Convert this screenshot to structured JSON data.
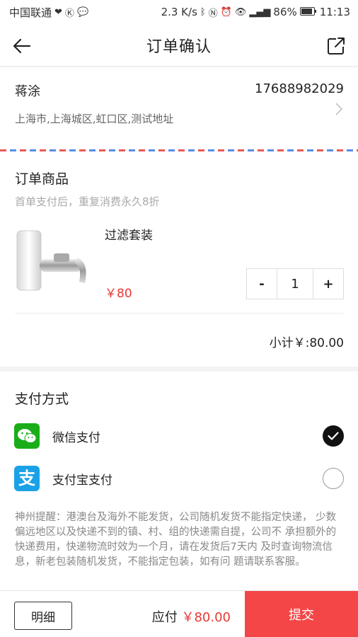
{
  "status_bar": {
    "carrier": "中国联通",
    "speed": "2.3 K/s",
    "battery": "86%",
    "time": "11:13"
  },
  "header": {
    "title": "订单确认",
    "back_icon": "arrow-left-icon",
    "share_icon": "share-icon"
  },
  "address": {
    "name": "蒋涂",
    "phone": "17688982029",
    "address_line": "上海市,上海城区,虹口区,测试地址"
  },
  "goods": {
    "section_title": "订单商品",
    "promo_text": "首单支付后，重复消费永久8折",
    "product": {
      "name": "过滤套装",
      "price": "￥80",
      "quantity": "1",
      "decrement_label": "-",
      "increment_label": "+"
    },
    "subtotal": "小计￥:80.00"
  },
  "payment": {
    "section_title": "支付方式",
    "methods": [
      {
        "label": "微信支付",
        "icon": "wechat-icon",
        "selected": true
      },
      {
        "label": "支付宝支付",
        "icon": "alipay-icon",
        "selected": false
      }
    ],
    "notice": "神州提醒：港澳台及海外不能发货，公司随机发货不能指定快递， 少数偏远地区以及快递不到的镇、村、组的快递需自提，公司不 承担额外的快递费用，快递物流时效为一个月，请在发货后7天内 及时查询物流信息，新老包装随机发货，不能指定包装，如有问 题请联系客服。"
  },
  "footer": {
    "detail_label": "明细",
    "payable_label": "应付",
    "payable_amount": "￥80.00",
    "submit_label": "提交"
  },
  "colors": {
    "accent_red": "#f44646",
    "price_red": "#e53935",
    "wechat_green": "#1aad19",
    "alipay_blue": "#1aa1e6"
  }
}
